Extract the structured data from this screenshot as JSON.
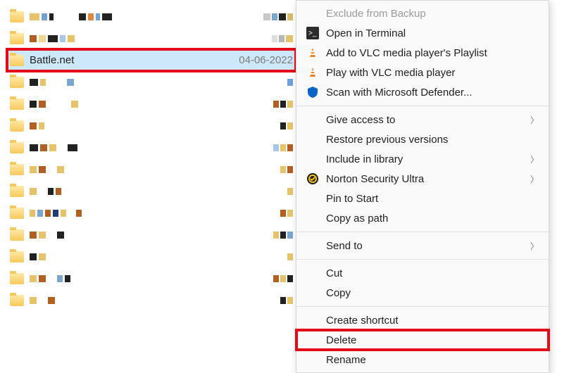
{
  "file_list": {
    "selected_row": {
      "name": "Battle.net",
      "date": "04-06-2022"
    }
  },
  "context_menu": {
    "exclude_backup": "Exclude from Backup",
    "open_terminal": "Open in Terminal",
    "add_vlc": "Add to VLC media player's Playlist",
    "play_vlc": "Play with VLC media player",
    "scan_defender": "Scan with Microsoft Defender...",
    "give_access": "Give access to",
    "restore_versions": "Restore previous versions",
    "include_library": "Include in library",
    "norton": "Norton Security Ultra",
    "pin_start": "Pin to Start",
    "copy_path": "Copy as path",
    "send_to": "Send to",
    "cut": "Cut",
    "copy": "Copy",
    "create_shortcut": "Create shortcut",
    "delete": "Delete",
    "rename": "Rename"
  },
  "icons": {
    "terminal": "terminal-icon",
    "vlc": "vlc-icon",
    "defender": "defender-icon",
    "norton": "norton-icon"
  }
}
